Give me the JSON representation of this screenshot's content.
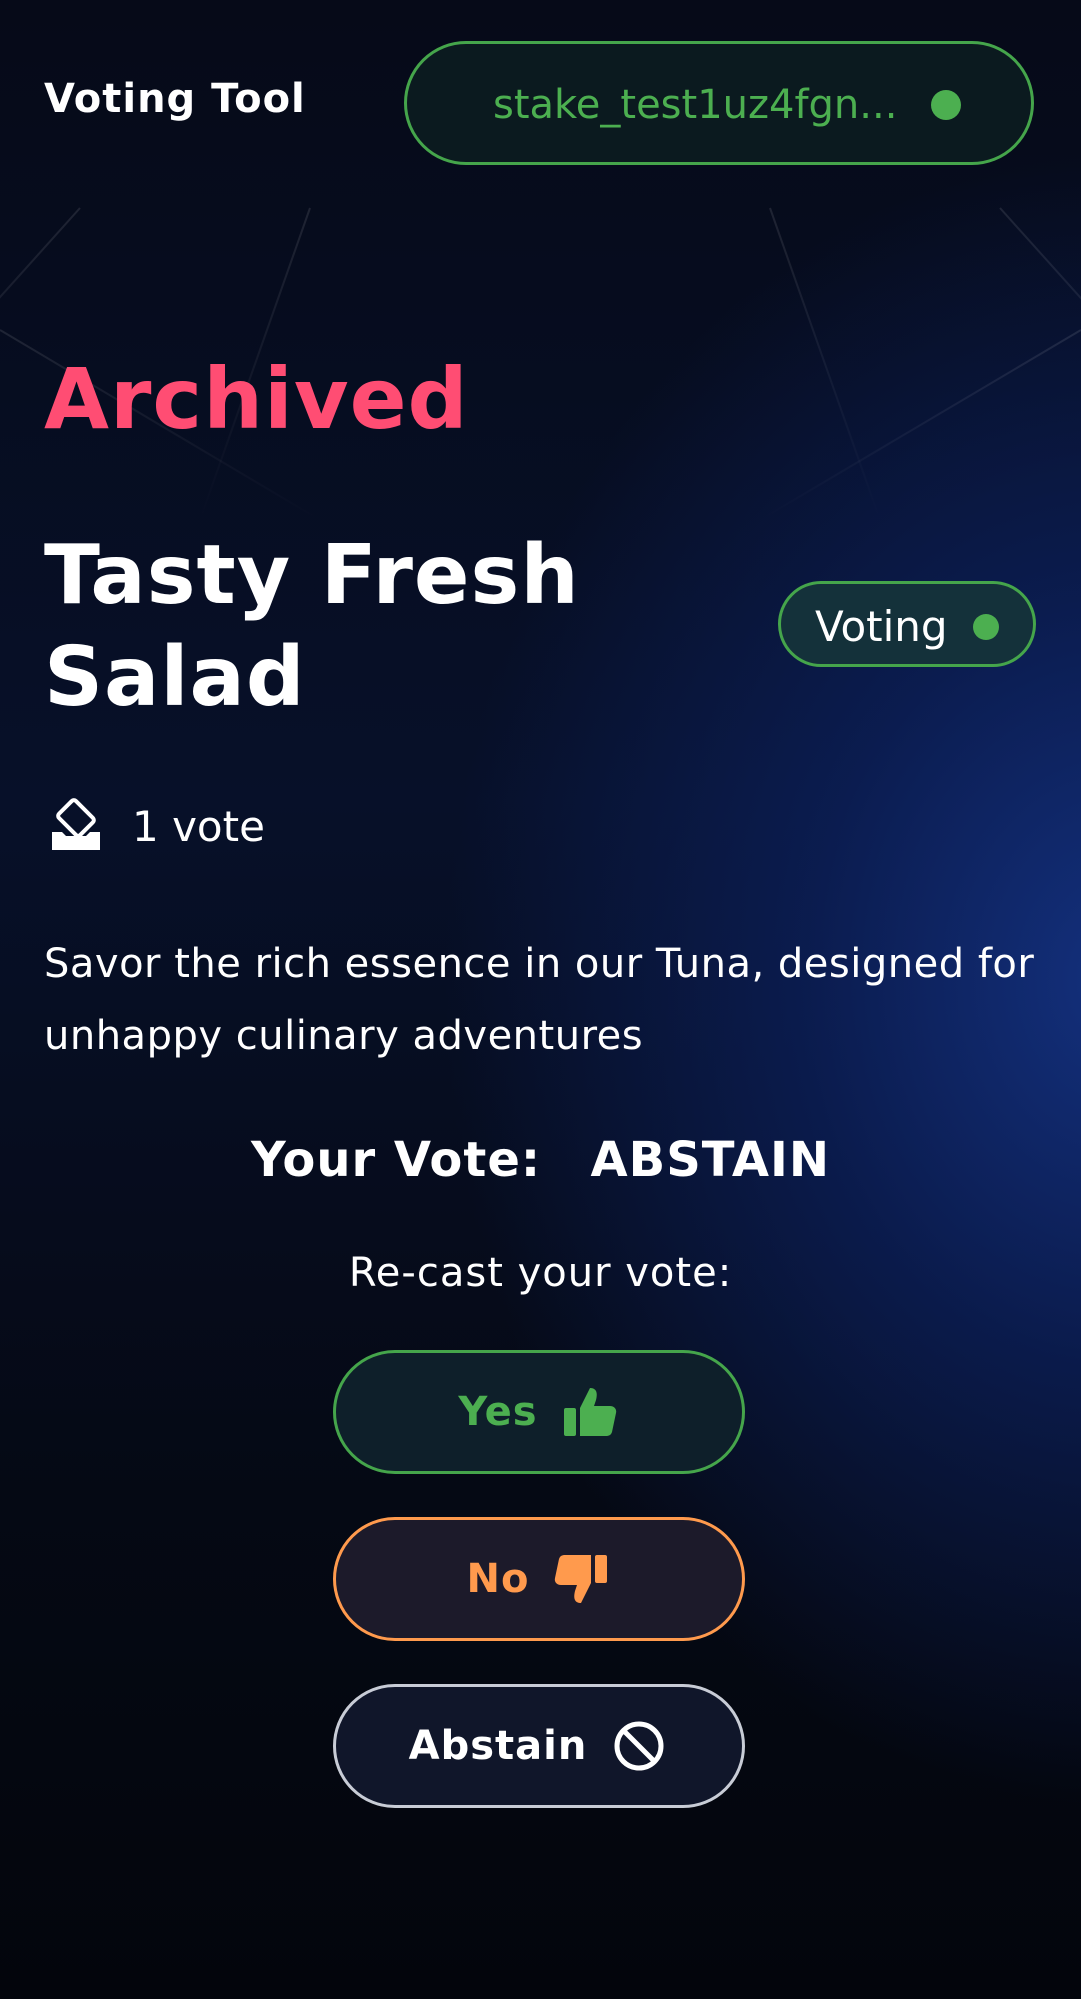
{
  "header": {
    "app_title": "Voting Tool",
    "wallet_address": "stake_test1uz4fgn...",
    "wallet_status_color": "#4caf50"
  },
  "proposal": {
    "status_heading": "Archived",
    "title": "Tasty Fresh Salad",
    "badge_label": "Voting",
    "vote_count": "1 vote",
    "description": "Savor the rich essence in our Tuna, designed for unhappy culinary adventures"
  },
  "vote": {
    "your_vote_label": "Your Vote:",
    "your_vote_value": "ABSTAIN",
    "recast_label": "Re-cast your vote:",
    "yes_label": "Yes",
    "no_label": "No",
    "abstain_label": "Abstain"
  },
  "icons": {
    "vote_count": "ballot-icon",
    "yes": "thumbs-up-icon",
    "no": "thumbs-down-icon",
    "abstain": "ban-icon"
  },
  "colors": {
    "status_archived": "#ff4d73",
    "accent_green": "#4caf50",
    "accent_orange": "#ff9a4d",
    "neutral_border": "#c8ccd6"
  }
}
